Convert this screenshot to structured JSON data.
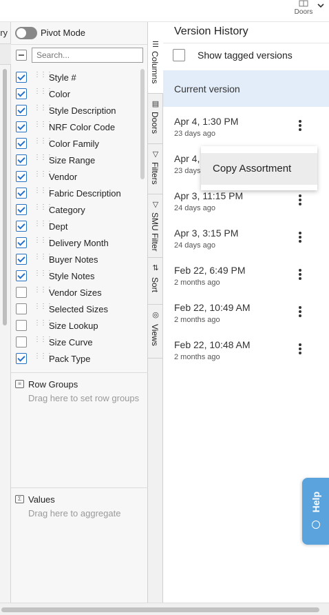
{
  "header": {
    "doors_label": "Doors"
  },
  "left_strip": {
    "partial_text": "ory"
  },
  "tool_panel": {
    "pivot_mode_label": "Pivot Mode",
    "search_placeholder": "Search...",
    "columns": [
      {
        "label": "Style #",
        "checked": true
      },
      {
        "label": "Color",
        "checked": true
      },
      {
        "label": "Style Description",
        "checked": true
      },
      {
        "label": "NRF Color Code",
        "checked": true
      },
      {
        "label": "Color Family",
        "checked": true
      },
      {
        "label": "Size Range",
        "checked": true
      },
      {
        "label": "Vendor",
        "checked": true
      },
      {
        "label": "Fabric Description",
        "checked": true
      },
      {
        "label": "Category",
        "checked": true
      },
      {
        "label": "Dept",
        "checked": true
      },
      {
        "label": "Delivery Month",
        "checked": true
      },
      {
        "label": "Buyer Notes",
        "checked": true
      },
      {
        "label": "Style Notes",
        "checked": true
      },
      {
        "label": "Vendor Sizes",
        "checked": false
      },
      {
        "label": "Selected Sizes",
        "checked": false
      },
      {
        "label": "Size Lookup",
        "checked": false
      },
      {
        "label": "Size Curve",
        "checked": false
      },
      {
        "label": "Pack Type",
        "checked": true
      }
    ],
    "row_groups": {
      "title": "Row Groups",
      "hint": "Drag here to set row groups"
    },
    "values": {
      "title": "Values",
      "hint": "Drag here to aggregate"
    }
  },
  "side_tabs": [
    {
      "label": "Columns",
      "icon": "columns-icon"
    },
    {
      "label": "Doors",
      "icon": "doors-icon"
    },
    {
      "label": "Filters",
      "icon": "filter-icon"
    },
    {
      "label": "SMU Filter",
      "icon": "filter-icon"
    },
    {
      "label": "Sort",
      "icon": "sort-icon"
    },
    {
      "label": "Views",
      "icon": "eye-icon"
    }
  ],
  "version_history": {
    "title": "Version History",
    "show_tagged_label": "Show tagged versions",
    "current_label": "Current version",
    "versions": [
      {
        "date": "Apr 4, 1:30 PM",
        "ago": "23 days ago"
      },
      {
        "date": "Apr 4,",
        "ago": "23 days"
      },
      {
        "date": "Apr 3, 11:15 PM",
        "ago": "24 days ago"
      },
      {
        "date": "Apr 3, 3:15 PM",
        "ago": "24 days ago"
      },
      {
        "date": "Feb 22, 6:49 PM",
        "ago": "2 months ago"
      },
      {
        "date": "Feb 22, 10:49 AM",
        "ago": "2 months ago"
      },
      {
        "date": "Feb 22, 10:48 AM",
        "ago": "2 months ago"
      }
    ],
    "context_menu": {
      "copy_label": "Copy Assortment"
    }
  },
  "help": {
    "label": "Help"
  }
}
